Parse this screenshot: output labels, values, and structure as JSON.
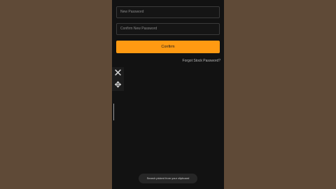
{
  "form": {
    "new_password_placeholder": "New Password",
    "confirm_password_placeholder": "Confirm New Password",
    "confirm_button": "Confirm",
    "forgot_link": "Forgot Stock Password?"
  },
  "floating_panel": {
    "close_icon": "close-icon",
    "move_icon": "move-icon"
  },
  "toast": {
    "message": "Search picked from your clipboard"
  },
  "colors": {
    "background": "#5f4a37",
    "screen": "#121212",
    "accent": "#ff9a12"
  }
}
